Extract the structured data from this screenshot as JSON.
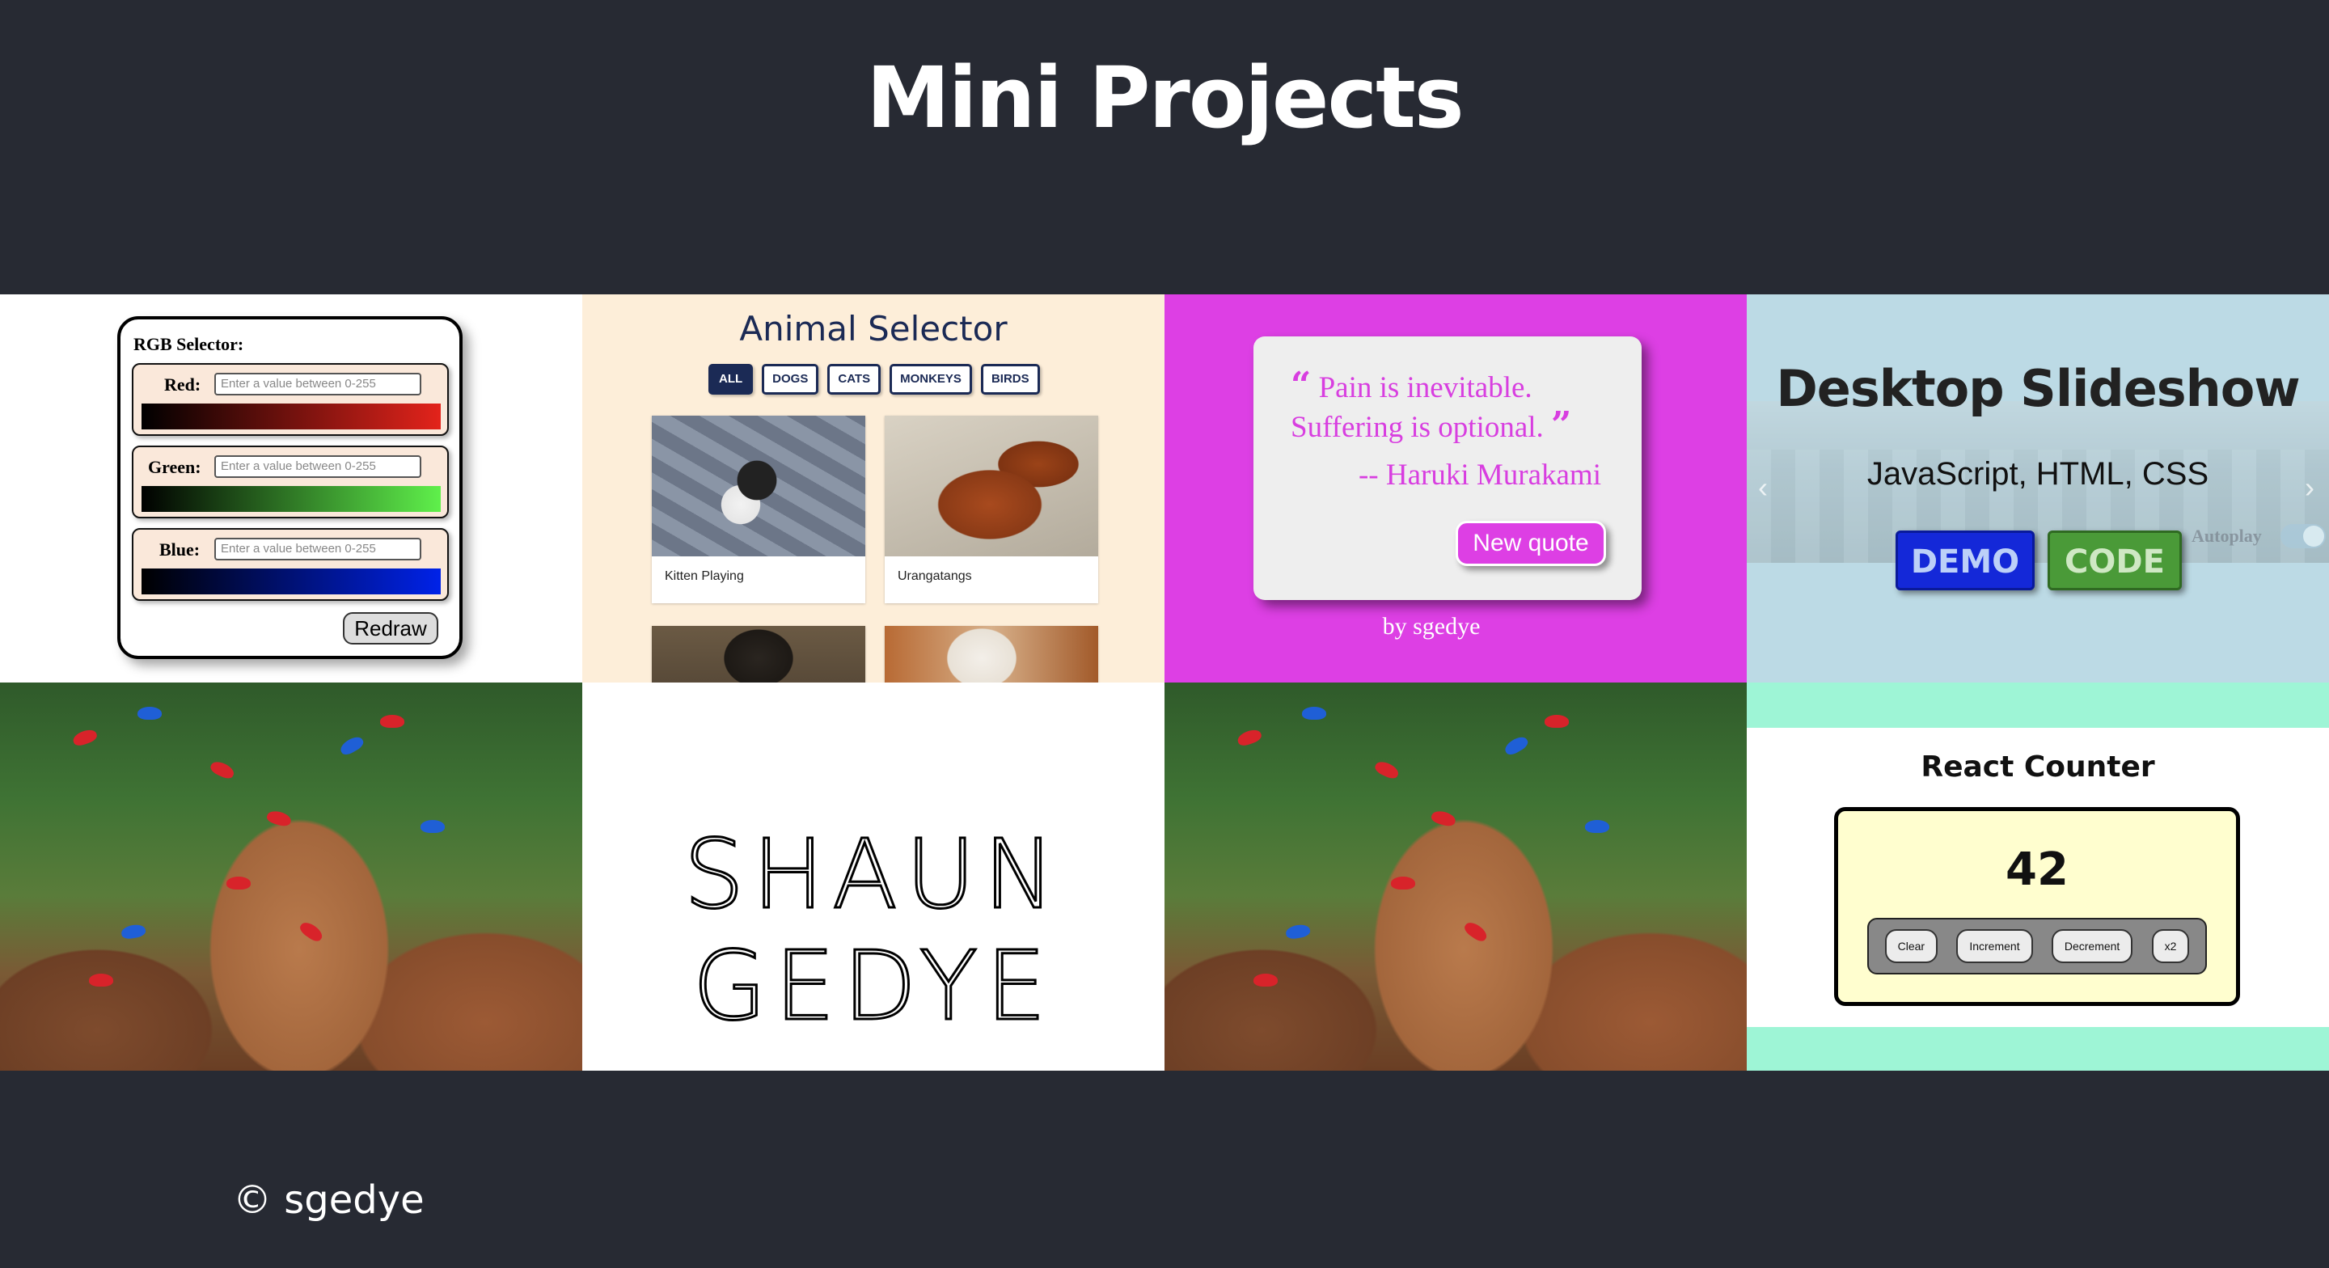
{
  "page": {
    "title": "Mini Projects"
  },
  "rgb": {
    "title": "RGB Selector:",
    "rows": [
      {
        "label": "Red:",
        "placeholder": "Enter a value between 0-255",
        "gradient_end": "#e3231b"
      },
      {
        "label": "Green:",
        "placeholder": "Enter a value between 0-255",
        "gradient_end": "#5ff04b"
      },
      {
        "label": "Blue:",
        "placeholder": "Enter a value between 0-255",
        "gradient_end": "#0022e8"
      }
    ],
    "redraw_label": "Redraw"
  },
  "animals": {
    "title": "Animal Selector",
    "filters": [
      "ALL",
      "DOGS",
      "CATS",
      "MONKEYS",
      "BIRDS"
    ],
    "active_filter": "ALL",
    "cards": [
      {
        "caption": "Kitten Playing"
      },
      {
        "caption": "Urangatangs"
      }
    ]
  },
  "quote": {
    "open_mark": "“",
    "text": "Pain is inevitable. Suffering is optional.",
    "close_mark": "”",
    "author": "-- Haruki Murakami",
    "button_label": "New quote",
    "byline": "by sgedye"
  },
  "slideshow": {
    "title": "Desktop Slideshow",
    "subtitle": "JavaScript, HTML, CSS",
    "demo_label": "DEMO",
    "code_label": "CODE",
    "autoplay_label": "Autoplay",
    "prev_glyph": "‹",
    "next_glyph": "›"
  },
  "signature": {
    "text": "SHAUN GEDYE"
  },
  "counter": {
    "title": "React Counter",
    "value": "42",
    "buttons": [
      "Clear",
      "Increment",
      "Decrement",
      "x2"
    ]
  },
  "footer": {
    "text": "© sgedye"
  },
  "colors": {
    "background": "#272a33",
    "animal_bg": "#fdeed9",
    "quote_bg": "#dd3fe4",
    "slideshow_bg": "#bcdae5",
    "counter_bg": "#9ef5d6",
    "navy": "#1b2a55"
  }
}
